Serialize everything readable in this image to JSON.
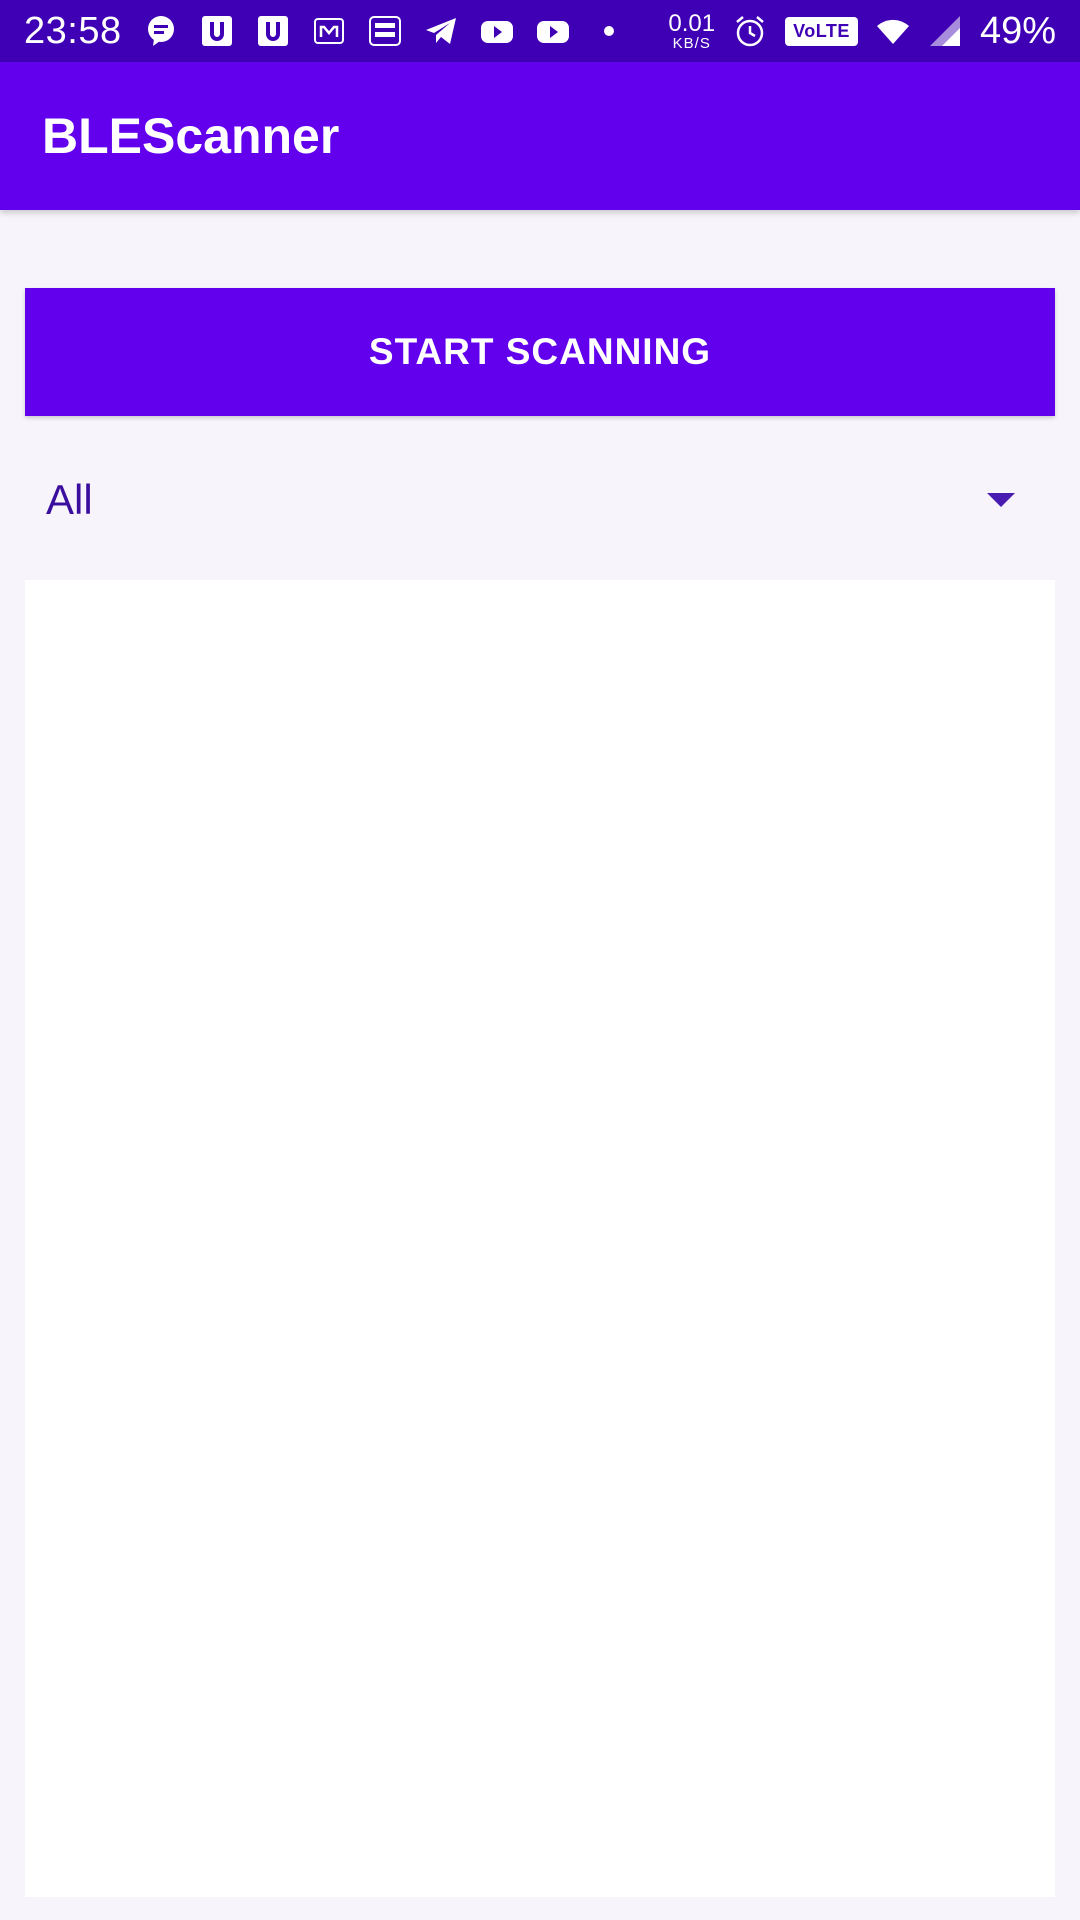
{
  "status_bar": {
    "time": "23:58",
    "icons": [
      "chat-bubble-icon",
      "u-app-icon",
      "u-app-icon-2",
      "m-app-icon",
      "payzapp-icon",
      "telegram-icon",
      "youtube-icon",
      "youtube-icon-2",
      "dot-icon"
    ],
    "net_speed_value": "0.01",
    "net_speed_unit": "KB/S",
    "volte_label": "VoLTE",
    "battery": "49%"
  },
  "app_bar": {
    "title": "BLEScanner"
  },
  "scan_button": {
    "label": "START SCANNING"
  },
  "filter": {
    "selected": "All"
  },
  "colors": {
    "status_bar": "#3f00b5",
    "primary": "#6200ee",
    "background": "#f7f5fb",
    "list_background": "#ffffff",
    "filter_text": "#3b0f9e"
  }
}
